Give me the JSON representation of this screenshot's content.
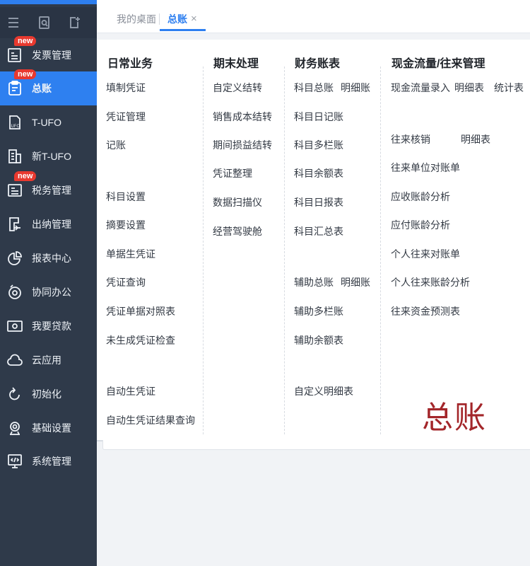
{
  "sidebar": {
    "items": [
      {
        "label": "发票管理",
        "badge": "new"
      },
      {
        "label": "总账",
        "badge": "new",
        "active": true
      },
      {
        "label": "T-UFO"
      },
      {
        "label": "新T-UFO"
      },
      {
        "label": "税务管理",
        "badge": "new"
      },
      {
        "label": "出纳管理"
      },
      {
        "label": "报表中心"
      },
      {
        "label": "协同办公"
      },
      {
        "label": "我要贷款"
      },
      {
        "label": "云应用"
      },
      {
        "label": "初始化"
      },
      {
        "label": "基础设置"
      },
      {
        "label": "系统管理"
      }
    ],
    "tools": [
      "menu-icon",
      "search-icon",
      "add-icon"
    ]
  },
  "tabs": [
    {
      "label": "我的桌面"
    },
    {
      "label": "总账",
      "active": true,
      "close": "×"
    }
  ],
  "columns": {
    "daily": {
      "title": "日常业务",
      "items": [
        "填制凭证",
        "凭证管理",
        "记账",
        "科目设置",
        "摘要设置",
        "单据生凭证",
        "凭证查询",
        "凭证单据对照表",
        "未生成凭证检查",
        "自动生凭证",
        "自动生凭证结果查询"
      ]
    },
    "period": {
      "title": "期末处理",
      "items": [
        "自定义结转",
        "销售成本结转",
        "期间损益结转",
        "凭证整理",
        "数据扫描仪",
        "经营驾驶舱"
      ]
    },
    "books": {
      "title": "财务账表",
      "items": [
        "科目总账",
        "明细账",
        "科目日记账",
        "科目多栏账",
        "科目余额表",
        "科目日报表",
        "科目汇总表",
        "辅助总账",
        "明细账",
        "辅助多栏账",
        "辅助余额表",
        "自定义明细表"
      ]
    },
    "cash": {
      "title": "现金流量/往来管理",
      "items": [
        "现金流量录入",
        "明细表",
        "统计表",
        "往来核销",
        "明细表",
        "往来单位对账单",
        "应收账龄分析",
        "应付账龄分析",
        "个人往来对账单",
        "个人往来账龄分析",
        "往来资金预测表"
      ]
    }
  },
  "watermark": "总账",
  "colors": {
    "accent": "#2e7ff0",
    "sidebar": "#2f3a4a",
    "badge": "#e8392f",
    "watermark": "#a3262a"
  }
}
